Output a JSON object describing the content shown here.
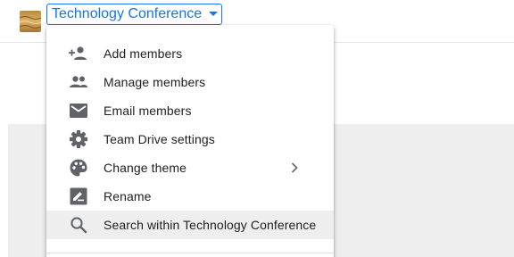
{
  "header": {
    "drive_title": "Technology Conference",
    "thumbnail_icon": "team-drive-thumbnail",
    "caret_icon": "caret-down-icon"
  },
  "colors": {
    "accent": "#1a73e8",
    "icon_grey": "#5f6368",
    "text": "#202124",
    "hover_bg": "#eeeeee",
    "content_bg": "#eeeeee"
  },
  "menu": {
    "items": [
      {
        "label": "Add members",
        "icon": "add-person-icon"
      },
      {
        "label": "Manage members",
        "icon": "people-icon"
      },
      {
        "label": "Email members",
        "icon": "email-icon"
      },
      {
        "label": "Team Drive settings",
        "icon": "gear-icon"
      },
      {
        "label": "Change theme",
        "icon": "palette-icon",
        "has_submenu": true
      },
      {
        "label": "Rename",
        "icon": "rename-icon"
      },
      {
        "label": "Search within Technology Conference",
        "icon": "search-icon",
        "highlighted": true
      }
    ]
  }
}
